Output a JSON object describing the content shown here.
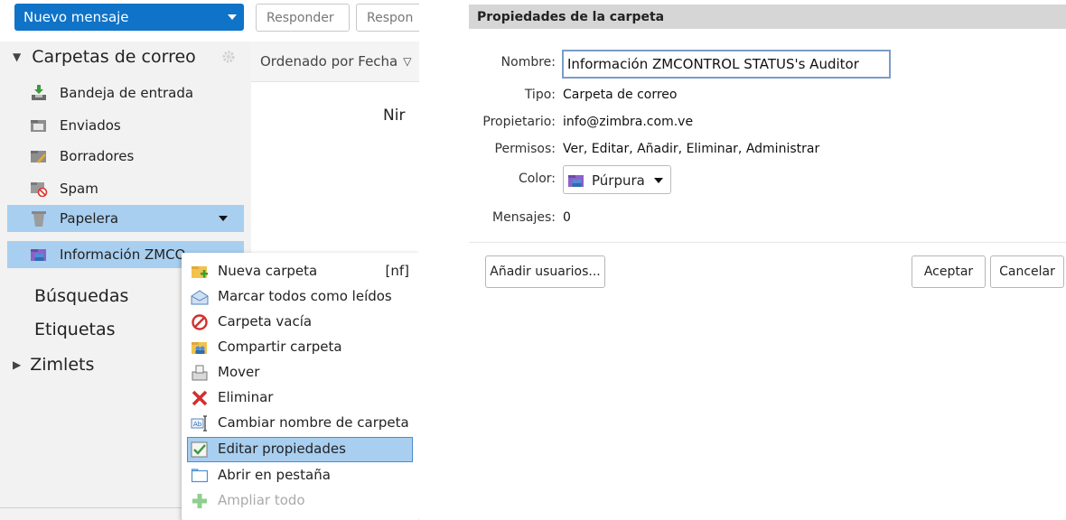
{
  "toolbar": {
    "new_message": "Nuevo mensaje",
    "reply": "Responder",
    "reply_all": "Respon"
  },
  "sidebar": {
    "mail_folders": "Carpetas de correo",
    "folders": [
      {
        "label": "Bandeja de entrada",
        "icon": "inbox-icon"
      },
      {
        "label": "Enviados",
        "icon": "sent-icon"
      },
      {
        "label": "Borradores",
        "icon": "drafts-icon"
      },
      {
        "label": "Spam",
        "icon": "spam-icon"
      },
      {
        "label": "Papelera",
        "icon": "trash-icon"
      },
      {
        "label": "Información ZMCO",
        "icon": "shared-folder-icon"
      }
    ],
    "searches": "Búsquedas",
    "tags": "Etiquetas",
    "zimlets": "Zimlets"
  },
  "list": {
    "sort_label": "Ordenado por Fecha",
    "empty_text": "Nir"
  },
  "context_menu": {
    "items": [
      {
        "label": "Nueva carpeta",
        "shortcut": "[nf]"
      },
      {
        "label": "Marcar todos como leídos"
      },
      {
        "label": "Carpeta vacía"
      },
      {
        "label": "Compartir carpeta"
      },
      {
        "label": "Mover"
      },
      {
        "label": "Eliminar"
      },
      {
        "label": "Cambiar nombre de carpeta"
      },
      {
        "label": "Editar propiedades"
      },
      {
        "label": "Abrir en pestaña"
      },
      {
        "label": "Ampliar todo"
      }
    ]
  },
  "dialog": {
    "title": "Propiedades de la carpeta",
    "name_label": "Nombre:",
    "name_value": "Información ZMCONTROL STATUS's Auditor",
    "type_label": "Tipo:",
    "type_value": "Carpeta de correo",
    "owner_label": "Propietario:",
    "owner_value": "info@zimbra.com.ve",
    "perm_label": "Permisos:",
    "perm_value": "Ver, Editar, Añadir, Eliminar, Administrar",
    "color_label": "Color:",
    "color_value": "Púrpura",
    "messages_label": "Mensajes:",
    "messages_value": "0",
    "add_users": "Añadir usuarios...",
    "ok": "Aceptar",
    "cancel": "Cancelar"
  },
  "colors": {
    "accent": "#0f73c8",
    "selection": "#a8cff0",
    "purple": "#8a63c9"
  }
}
